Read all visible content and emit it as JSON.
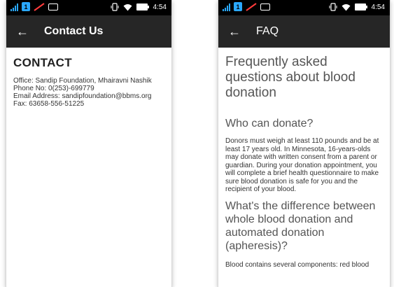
{
  "status_left": {
    "sim_label": "1",
    "time": "4:54"
  },
  "status_right": {
    "sim_label": "1",
    "time": "4:54"
  },
  "contact_screen": {
    "appbar_title": "Contact Us",
    "heading": "CONTACT",
    "lines": [
      "Office: Sandip Foundation, Mhairavni Nashik",
      "Phone No: 0(253)-699779",
      "Email Address: sandipfoundation@bbms.org",
      "Fax: 63658-556-51225"
    ]
  },
  "faq_screen": {
    "appbar_title": "FAQ",
    "main_heading": "Frequently asked questions about blood donation",
    "q1_title": "Who can donate?",
    "q1_answer": "Donors must weigh at least 110 pounds and be at least 17 years old. In Minnesota, 16-years-olds may donate with written consent from a parent or guardian. During your donation appointment, you will complete a brief health questionnaire to make sure blood donation is safe for you and the recipient of your blood.",
    "q2_title": "What's the difference between whole blood donation and automated donation (apheresis)?",
    "q2_answer_cut": "Blood contains several components: red blood"
  },
  "colors": {
    "signal": "#2aa8ff",
    "appbar": "#262626",
    "statusbar": "#000000"
  }
}
